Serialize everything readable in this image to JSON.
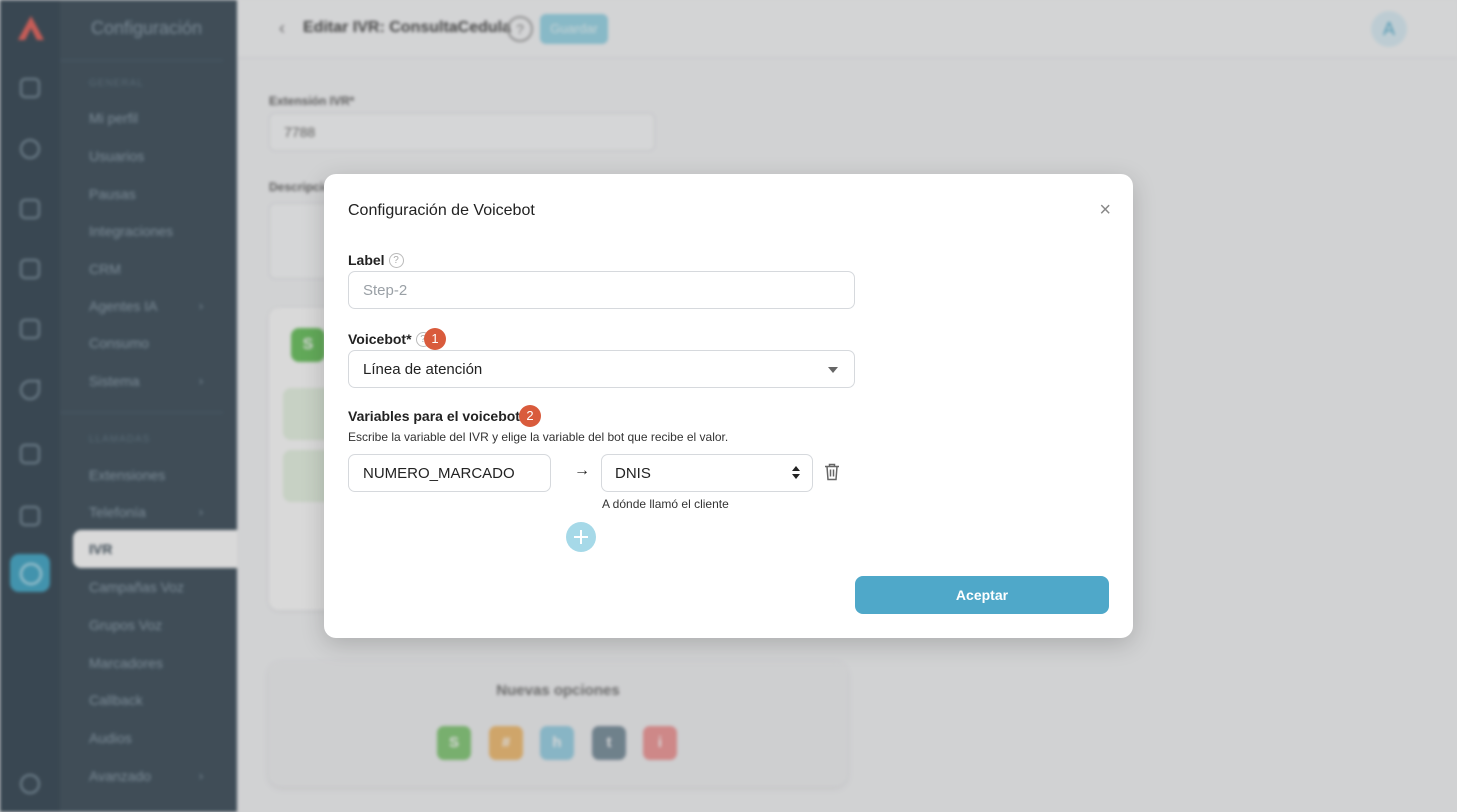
{
  "sidebar": {
    "title": "Configuración",
    "section_general": "GENERAL",
    "section_llamadas": "LLAMADAS",
    "general_items": [
      "Mi perfil",
      "Usuarios",
      "Pausas",
      "Integraciones",
      "CRM",
      "Agentes IA",
      "Consumo",
      "Sistema"
    ],
    "llamadas_items": [
      "Extensiones",
      "Telefonía",
      "IVR",
      "Campañas Voz",
      "Grupos Voz",
      "Marcadores",
      "Callback",
      "Audios",
      "Avanzado"
    ],
    "active_item": "IVR"
  },
  "header": {
    "title": "Editar IVR: ConsultaCedula",
    "save_label": "Guardar",
    "avatar_letter": "A"
  },
  "background_form": {
    "extension_label": "Extensión IVR*",
    "extension_value": "7788",
    "description_label": "Descripción",
    "card_chip": "S",
    "nuevas_title": "Nuevas opciones",
    "chips": [
      {
        "letter": "S",
        "color": "#79c56b"
      },
      {
        "letter": "#",
        "color": "#f2b866"
      },
      {
        "letter": "h",
        "color": "#8fcde3"
      },
      {
        "letter": "t",
        "color": "#6d8594"
      },
      {
        "letter": "i",
        "color": "#f08f8f"
      }
    ]
  },
  "modal": {
    "title": "Configuración de Voicebot",
    "close_icon": "×",
    "label_field": {
      "label": "Label",
      "placeholder": "Step-2"
    },
    "voicebot_field": {
      "label": "Voicebot*",
      "badge": "1",
      "value": "Línea de atención"
    },
    "variables": {
      "label": "Variables para el voicebot",
      "badge": "2",
      "description": "Escribe la variable del IVR y elige la variable del bot que recibe el valor.",
      "ivr_variable": "NUMERO_MARCADO",
      "arrow": "→",
      "bot_variable": "DNIS",
      "bot_variable_hint": "A dónde llamó el cliente"
    },
    "accept_label": "Aceptar"
  },
  "colors": {
    "sidebar_bg": "#2b3e4c",
    "accent": "#4fa8c9",
    "badge": "#d95b3c"
  }
}
